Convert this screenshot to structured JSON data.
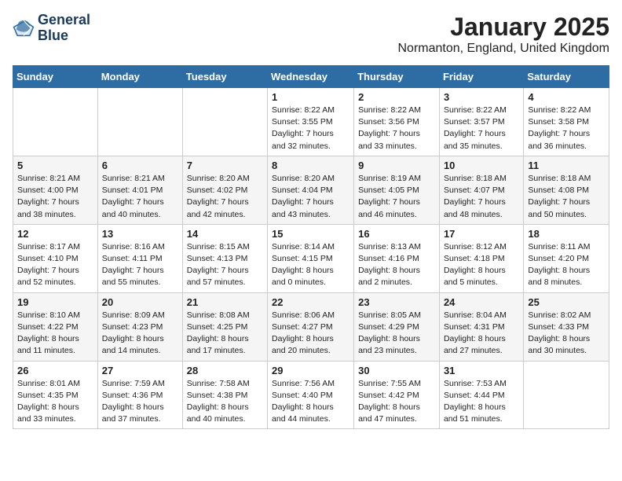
{
  "logo": {
    "line1": "General",
    "line2": "Blue"
  },
  "title": "January 2025",
  "location": "Normanton, England, United Kingdom",
  "weekdays": [
    "Sunday",
    "Monday",
    "Tuesday",
    "Wednesday",
    "Thursday",
    "Friday",
    "Saturday"
  ],
  "weeks": [
    [
      {
        "day": "",
        "info": ""
      },
      {
        "day": "",
        "info": ""
      },
      {
        "day": "",
        "info": ""
      },
      {
        "day": "1",
        "info": "Sunrise: 8:22 AM\nSunset: 3:55 PM\nDaylight: 7 hours and 32 minutes."
      },
      {
        "day": "2",
        "info": "Sunrise: 8:22 AM\nSunset: 3:56 PM\nDaylight: 7 hours and 33 minutes."
      },
      {
        "day": "3",
        "info": "Sunrise: 8:22 AM\nSunset: 3:57 PM\nDaylight: 7 hours and 35 minutes."
      },
      {
        "day": "4",
        "info": "Sunrise: 8:22 AM\nSunset: 3:58 PM\nDaylight: 7 hours and 36 minutes."
      }
    ],
    [
      {
        "day": "5",
        "info": "Sunrise: 8:21 AM\nSunset: 4:00 PM\nDaylight: 7 hours and 38 minutes."
      },
      {
        "day": "6",
        "info": "Sunrise: 8:21 AM\nSunset: 4:01 PM\nDaylight: 7 hours and 40 minutes."
      },
      {
        "day": "7",
        "info": "Sunrise: 8:20 AM\nSunset: 4:02 PM\nDaylight: 7 hours and 42 minutes."
      },
      {
        "day": "8",
        "info": "Sunrise: 8:20 AM\nSunset: 4:04 PM\nDaylight: 7 hours and 43 minutes."
      },
      {
        "day": "9",
        "info": "Sunrise: 8:19 AM\nSunset: 4:05 PM\nDaylight: 7 hours and 46 minutes."
      },
      {
        "day": "10",
        "info": "Sunrise: 8:18 AM\nSunset: 4:07 PM\nDaylight: 7 hours and 48 minutes."
      },
      {
        "day": "11",
        "info": "Sunrise: 8:18 AM\nSunset: 4:08 PM\nDaylight: 7 hours and 50 minutes."
      }
    ],
    [
      {
        "day": "12",
        "info": "Sunrise: 8:17 AM\nSunset: 4:10 PM\nDaylight: 7 hours and 52 minutes."
      },
      {
        "day": "13",
        "info": "Sunrise: 8:16 AM\nSunset: 4:11 PM\nDaylight: 7 hours and 55 minutes."
      },
      {
        "day": "14",
        "info": "Sunrise: 8:15 AM\nSunset: 4:13 PM\nDaylight: 7 hours and 57 minutes."
      },
      {
        "day": "15",
        "info": "Sunrise: 8:14 AM\nSunset: 4:15 PM\nDaylight: 8 hours and 0 minutes."
      },
      {
        "day": "16",
        "info": "Sunrise: 8:13 AM\nSunset: 4:16 PM\nDaylight: 8 hours and 2 minutes."
      },
      {
        "day": "17",
        "info": "Sunrise: 8:12 AM\nSunset: 4:18 PM\nDaylight: 8 hours and 5 minutes."
      },
      {
        "day": "18",
        "info": "Sunrise: 8:11 AM\nSunset: 4:20 PM\nDaylight: 8 hours and 8 minutes."
      }
    ],
    [
      {
        "day": "19",
        "info": "Sunrise: 8:10 AM\nSunset: 4:22 PM\nDaylight: 8 hours and 11 minutes."
      },
      {
        "day": "20",
        "info": "Sunrise: 8:09 AM\nSunset: 4:23 PM\nDaylight: 8 hours and 14 minutes."
      },
      {
        "day": "21",
        "info": "Sunrise: 8:08 AM\nSunset: 4:25 PM\nDaylight: 8 hours and 17 minutes."
      },
      {
        "day": "22",
        "info": "Sunrise: 8:06 AM\nSunset: 4:27 PM\nDaylight: 8 hours and 20 minutes."
      },
      {
        "day": "23",
        "info": "Sunrise: 8:05 AM\nSunset: 4:29 PM\nDaylight: 8 hours and 23 minutes."
      },
      {
        "day": "24",
        "info": "Sunrise: 8:04 AM\nSunset: 4:31 PM\nDaylight: 8 hours and 27 minutes."
      },
      {
        "day": "25",
        "info": "Sunrise: 8:02 AM\nSunset: 4:33 PM\nDaylight: 8 hours and 30 minutes."
      }
    ],
    [
      {
        "day": "26",
        "info": "Sunrise: 8:01 AM\nSunset: 4:35 PM\nDaylight: 8 hours and 33 minutes."
      },
      {
        "day": "27",
        "info": "Sunrise: 7:59 AM\nSunset: 4:36 PM\nDaylight: 8 hours and 37 minutes."
      },
      {
        "day": "28",
        "info": "Sunrise: 7:58 AM\nSunset: 4:38 PM\nDaylight: 8 hours and 40 minutes."
      },
      {
        "day": "29",
        "info": "Sunrise: 7:56 AM\nSunset: 4:40 PM\nDaylight: 8 hours and 44 minutes."
      },
      {
        "day": "30",
        "info": "Sunrise: 7:55 AM\nSunset: 4:42 PM\nDaylight: 8 hours and 47 minutes."
      },
      {
        "day": "31",
        "info": "Sunrise: 7:53 AM\nSunset: 4:44 PM\nDaylight: 8 hours and 51 minutes."
      },
      {
        "day": "",
        "info": ""
      }
    ]
  ]
}
